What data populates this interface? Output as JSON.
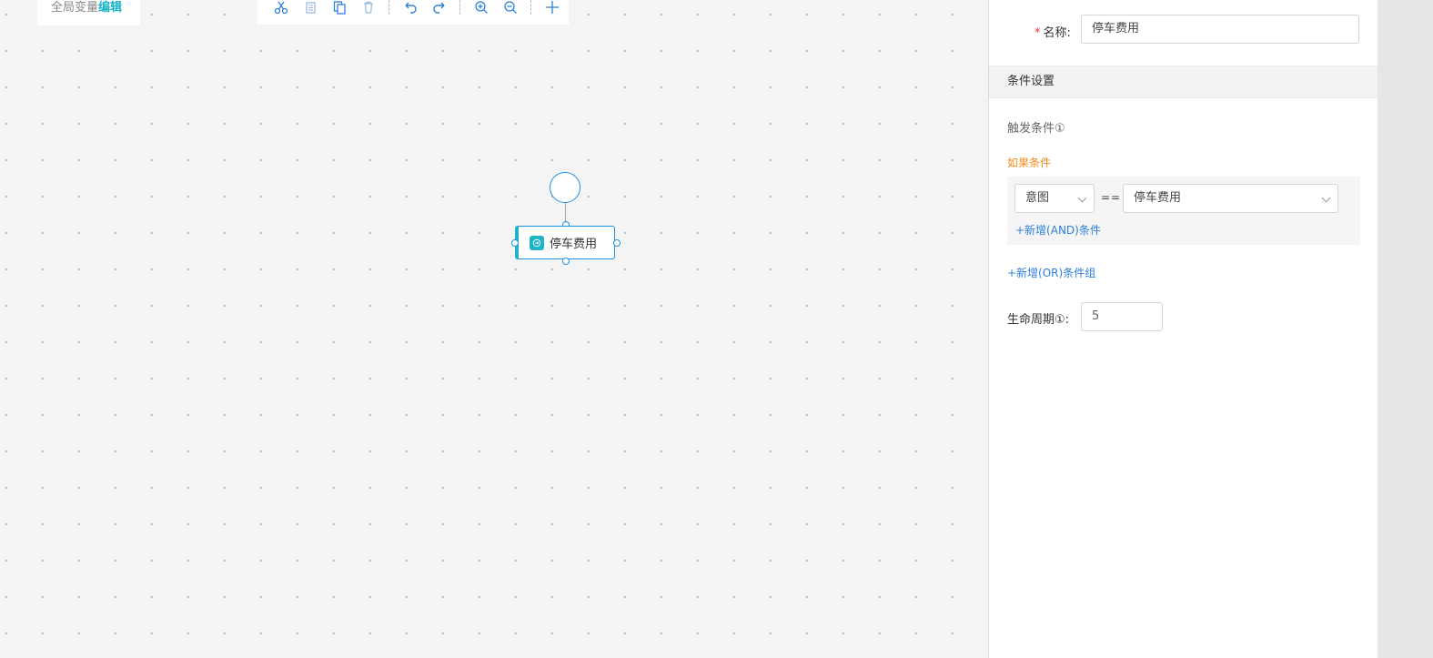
{
  "canvas": {
    "global_vars_label": "全局变量",
    "global_vars_edit": "编辑",
    "toolbar": {
      "icons": [
        "cut-icon",
        "copy-icon",
        "paste-icon",
        "delete-icon",
        "undo-icon",
        "redo-icon",
        "zoom-in-icon",
        "zoom-out-icon",
        "add-icon"
      ]
    },
    "node": {
      "label": "停车费用"
    }
  },
  "panel": {
    "name_label": "名称:",
    "name_required_mark": "*",
    "name_value": "停车费用",
    "section_title": "条件设置",
    "trigger_label": "触发条件①",
    "if_label": "如果条件",
    "condition": {
      "field": "意图",
      "operator": "==",
      "value": "停车费用"
    },
    "add_and": "+新增(AND)条件",
    "add_or": "+新增(OR)条件组",
    "lifecycle_label": "生命周期①:",
    "lifecycle_value": "5"
  },
  "colors": {
    "accent": "#1fb3c9",
    "link": "#2e7fd9",
    "warning": "#f08c1d",
    "node_border": "#1e90e6"
  }
}
